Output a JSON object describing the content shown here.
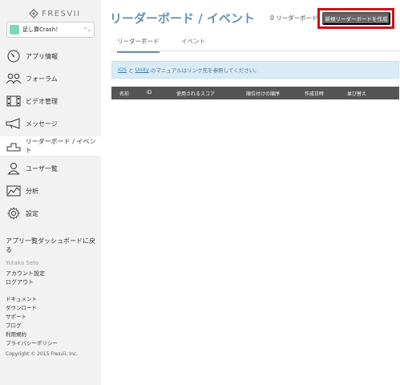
{
  "brand": {
    "name": "FRESVII"
  },
  "app_selector": {
    "value": "足し算Crash！",
    "icon": "app-icon"
  },
  "nav": [
    {
      "label": "アプリ情報",
      "icon": "gauge-icon"
    },
    {
      "label": "フォーラム",
      "icon": "users-icon"
    },
    {
      "label": "ビデオ管理",
      "icon": "film-icon"
    },
    {
      "label": "メッセージ",
      "icon": "megaphone-icon"
    },
    {
      "label": "リーダーボード / イベント",
      "icon": "podium-icon",
      "active": true
    },
    {
      "label": "ユーザ一覧",
      "icon": "user-icon"
    },
    {
      "label": "分析",
      "icon": "chart-icon"
    },
    {
      "label": "設定",
      "icon": "gear-icon"
    }
  ],
  "sidebar": {
    "back_link": "アプリ一覧ダッシュボードに戻る",
    "user_name": "Yutaka Seto",
    "account_links": [
      "アカウント設定",
      "ログアウト"
    ],
    "doc_links": [
      "ドキュメント",
      "ダウンロード",
      "サポート",
      "ブログ",
      "利用規約",
      "プライバシーポリシー"
    ],
    "copyright": "Copyright © 2015 Fresvii, Inc."
  },
  "header": {
    "title": "リーダーボード / イベント",
    "count": "0 リーダーボード",
    "new_button": "新規リーダーボードを作成"
  },
  "tabs": [
    {
      "label": "リーダーボード",
      "active": true
    },
    {
      "label": "イベント",
      "active": false
    }
  ],
  "info": {
    "link_ios": "iOS",
    "sep": " と ",
    "link_unity": "Unity",
    "text": " のマニュアルはリンク先を参照してください。"
  },
  "table": {
    "headers": [
      "名前",
      "ID",
      "使用されるスコア",
      "順位付けの順序",
      "作成日時",
      "並び替え"
    ]
  },
  "colors": {
    "accent": "#6a90b0",
    "highlight": "#cc1111",
    "button": "#666666",
    "table_header": "#555555",
    "info_bg": "#d9ecf6"
  }
}
